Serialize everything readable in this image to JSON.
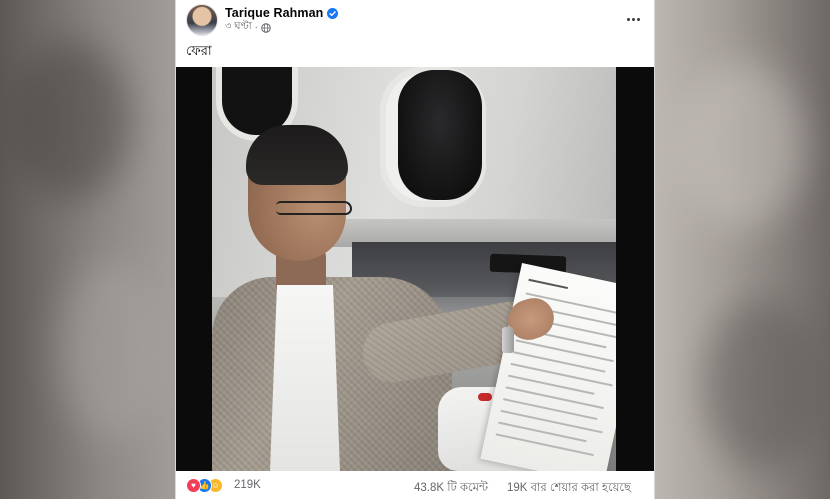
{
  "post": {
    "author": "Tarique Rahman",
    "time": "৩ ঘণ্টা",
    "separator": "·",
    "text": "ফেরা",
    "image_alt": ""
  },
  "engagement": {
    "reaction_count": "219K",
    "comments": "43.8K টি কমেন্ট",
    "shares": "19K বার শেয়ার করা হয়েছে"
  },
  "icons": {
    "verified": "verified-badge-icon",
    "audience": "globe-icon",
    "more": "more-options-icon",
    "reactions": [
      "love-icon",
      "like-icon",
      "haha-icon"
    ]
  },
  "colors": {
    "verified_blue": "#1877f2",
    "like_blue": "#1877f2",
    "love_red": "#f33e58",
    "haha_yellow": "#f7b928"
  }
}
